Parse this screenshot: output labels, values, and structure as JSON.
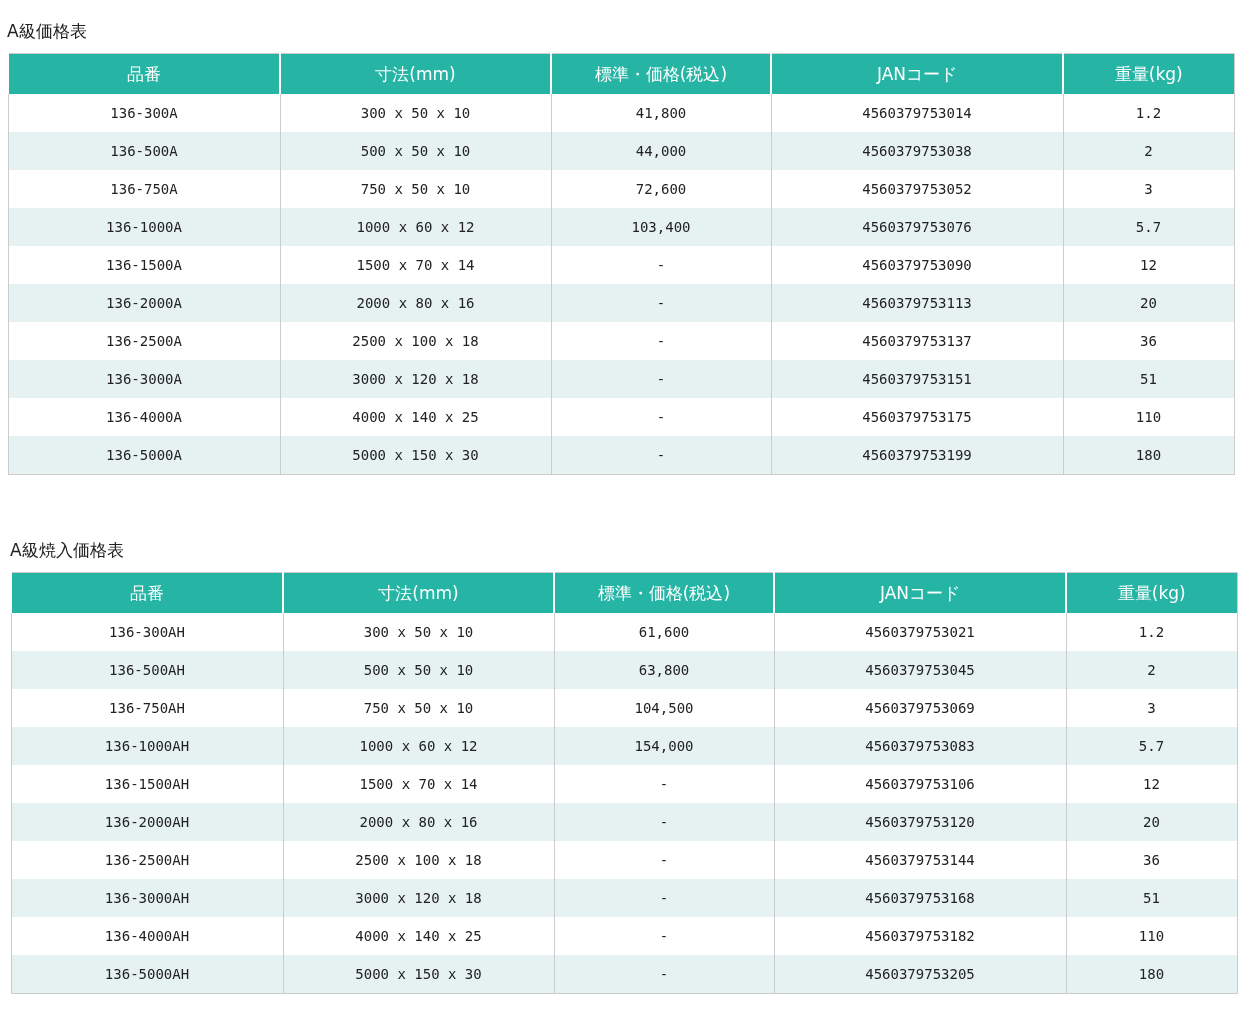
{
  "tables": [
    {
      "title": "A級価格表",
      "columns": [
        "品番",
        "寸法(mm)",
        "標準・価格(税込)",
        "JANコード",
        "重量(kg)"
      ],
      "rows": [
        [
          "136-300A",
          "300 x 50 x 10",
          "41,800",
          "4560379753014",
          "1.2"
        ],
        [
          "136-500A",
          "500 x 50 x 10",
          "44,000",
          "4560379753038",
          "2"
        ],
        [
          "136-750A",
          "750 x 50 x 10",
          "72,600",
          "4560379753052",
          "3"
        ],
        [
          "136-1000A",
          "1000 x 60 x 12",
          "103,400",
          "4560379753076",
          "5.7"
        ],
        [
          "136-1500A",
          "1500 x 70 x 14",
          "-",
          "4560379753090",
          "12"
        ],
        [
          "136-2000A",
          "2000 x 80 x 16",
          "-",
          "4560379753113",
          "20"
        ],
        [
          "136-2500A",
          "2500 x 100 x 18",
          "-",
          "4560379753137",
          "36"
        ],
        [
          "136-3000A",
          "3000 x 120 x 18",
          "-",
          "4560379753151",
          "51"
        ],
        [
          "136-4000A",
          "4000 x 140 x 25",
          "-",
          "4560379753175",
          "110"
        ],
        [
          "136-5000A",
          "5000 x 150 x 30",
          "-",
          "4560379753199",
          "180"
        ]
      ]
    },
    {
      "title": "A級焼入価格表",
      "columns": [
        "品番",
        "寸法(mm)",
        "標準・価格(税込)",
        "JANコード",
        "重量(kg)"
      ],
      "rows": [
        [
          "136-300AH",
          "300 x 50 x 10",
          "61,600",
          "4560379753021",
          "1.2"
        ],
        [
          "136-500AH",
          "500 x 50 x 10",
          "63,800",
          "4560379753045",
          "2"
        ],
        [
          "136-750AH",
          "750 x 50 x 10",
          "104,500",
          "4560379753069",
          "3"
        ],
        [
          "136-1000AH",
          "1000 x 60 x 12",
          "154,000",
          "4560379753083",
          "5.7"
        ],
        [
          "136-1500AH",
          "1500 x 70 x 14",
          "-",
          "4560379753106",
          "12"
        ],
        [
          "136-2000AH",
          "2000 x 80 x 16",
          "-",
          "4560379753120",
          "20"
        ],
        [
          "136-2500AH",
          "2500 x 100 x 18",
          "-",
          "4560379753144",
          "36"
        ],
        [
          "136-3000AH",
          "3000 x 120 x 18",
          "-",
          "4560379753168",
          "51"
        ],
        [
          "136-4000AH",
          "4000 x 140 x 25",
          "-",
          "4560379753182",
          "110"
        ],
        [
          "136-5000AH",
          "5000 x 150 x 30",
          "-",
          "4560379753205",
          "180"
        ]
      ]
    }
  ]
}
